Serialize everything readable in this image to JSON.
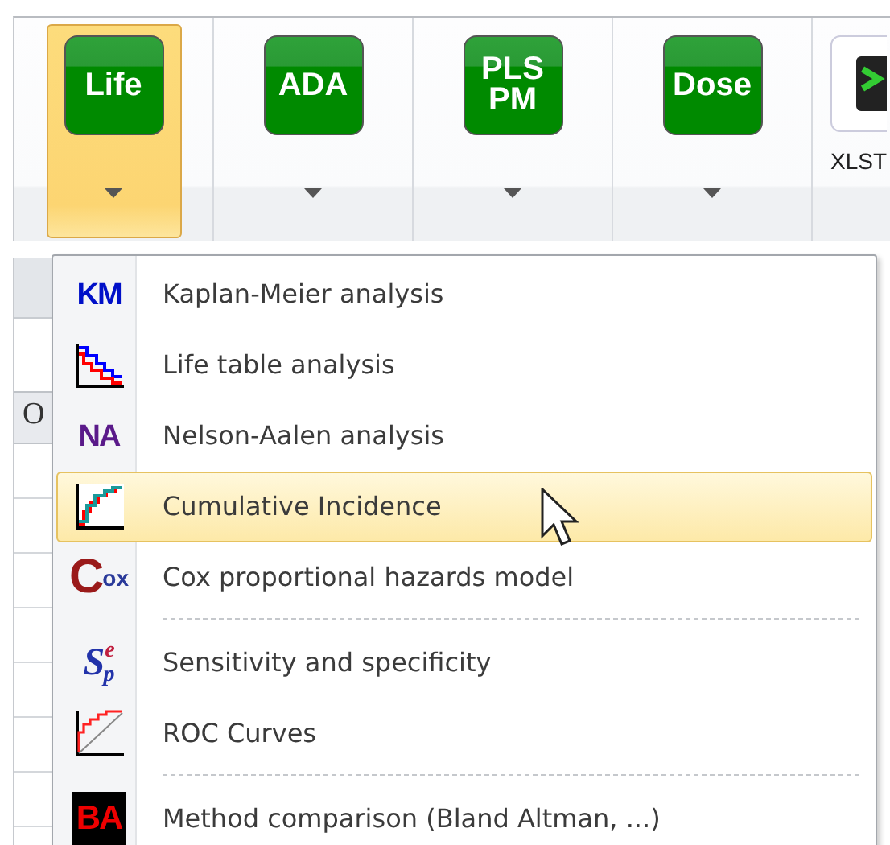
{
  "ribbon": {
    "buttons": [
      {
        "label": "Life",
        "selected": true,
        "kind": "green"
      },
      {
        "label": "ADA",
        "selected": false,
        "kind": "green"
      },
      {
        "label": "PLS PM",
        "selected": false,
        "kind": "green"
      },
      {
        "label": "Dose",
        "selected": false,
        "kind": "green"
      },
      {
        "label": "XLST",
        "selected": false,
        "kind": "terminal"
      }
    ]
  },
  "sheet": {
    "column_header": "O"
  },
  "menu": {
    "items": [
      {
        "label": "Kaplan-Meier analysis",
        "kind": "km",
        "icon_text": "KM",
        "selected": false,
        "separator_after": false
      },
      {
        "label": "Life table analysis",
        "kind": "lifetable",
        "selected": false,
        "separator_after": false
      },
      {
        "label": "Nelson-Aalen analysis",
        "kind": "na",
        "icon_text": "NA",
        "selected": false,
        "separator_after": false
      },
      {
        "label": "Cumulative Incidence",
        "kind": "cumulative",
        "selected": true,
        "separator_after": false
      },
      {
        "label": "Cox proportional hazards model",
        "kind": "cox",
        "icon_text": "ox",
        "icon_initial": "C",
        "selected": false,
        "separator_after": true
      },
      {
        "label": "Sensitivity and specificity",
        "kind": "sesp",
        "icon_text": "S$^{e}$$_{p}$",
        "selected": false,
        "separator_after": false
      },
      {
        "label": "ROC Curves",
        "kind": "roc",
        "selected": false,
        "separator_after": true
      },
      {
        "label": "Method comparison (Bland Altman, ...)",
        "kind": "ba",
        "icon_text": "BA",
        "selected": false,
        "separator_after": false
      }
    ]
  }
}
